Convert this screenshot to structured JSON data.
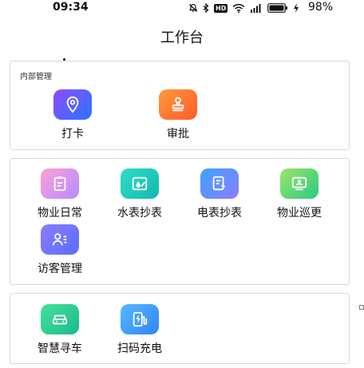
{
  "status_bar": {
    "time": "09:34",
    "icons": [
      "mute-icon",
      "bluetooth-icon",
      "hd-icon",
      "wifi-icon",
      "signal-icon",
      "battery-icon",
      "charging-icon"
    ],
    "hd_text": "HD",
    "battery_percent": "98%"
  },
  "header": {
    "title": "工作台"
  },
  "sections": [
    {
      "label": "内部管理",
      "items": [
        {
          "label": "打卡",
          "icon": "location-pin-icon",
          "color_start": "#8d4bff",
          "color_end": "#2b74ff"
        },
        {
          "label": "审批",
          "icon": "stamp-icon",
          "color_start": "#ff9a3c",
          "color_end": "#ff5a2a"
        }
      ]
    },
    {
      "label": "",
      "items": [
        {
          "label": "物业日常",
          "icon": "clipboard-icon",
          "color_start": "#ff9fd7",
          "color_end": "#b48dff"
        },
        {
          "label": "水表抄表",
          "icon": "water-meter-icon",
          "color_start": "#2fdfc6",
          "color_end": "#12b8b0"
        },
        {
          "label": "电表抄表",
          "icon": "electric-meter-icon",
          "color_start": "#3fa2ff",
          "color_end": "#8a7dff"
        },
        {
          "label": "物业巡更",
          "icon": "patrol-icon",
          "color_start": "#9de36b",
          "color_end": "#28cc80"
        },
        {
          "label": "访客管理",
          "icon": "visitor-icon",
          "color_start": "#8a7dff",
          "color_end": "#5b6cff"
        }
      ]
    },
    {
      "label": "",
      "items": [
        {
          "label": "智慧寻车",
          "icon": "car-icon",
          "color_start": "#44e29b",
          "color_end": "#1bb98c"
        },
        {
          "label": "扫码充电",
          "icon": "charging-pile-icon",
          "color_start": "#56b8ff",
          "color_end": "#2e86ff"
        }
      ]
    }
  ]
}
